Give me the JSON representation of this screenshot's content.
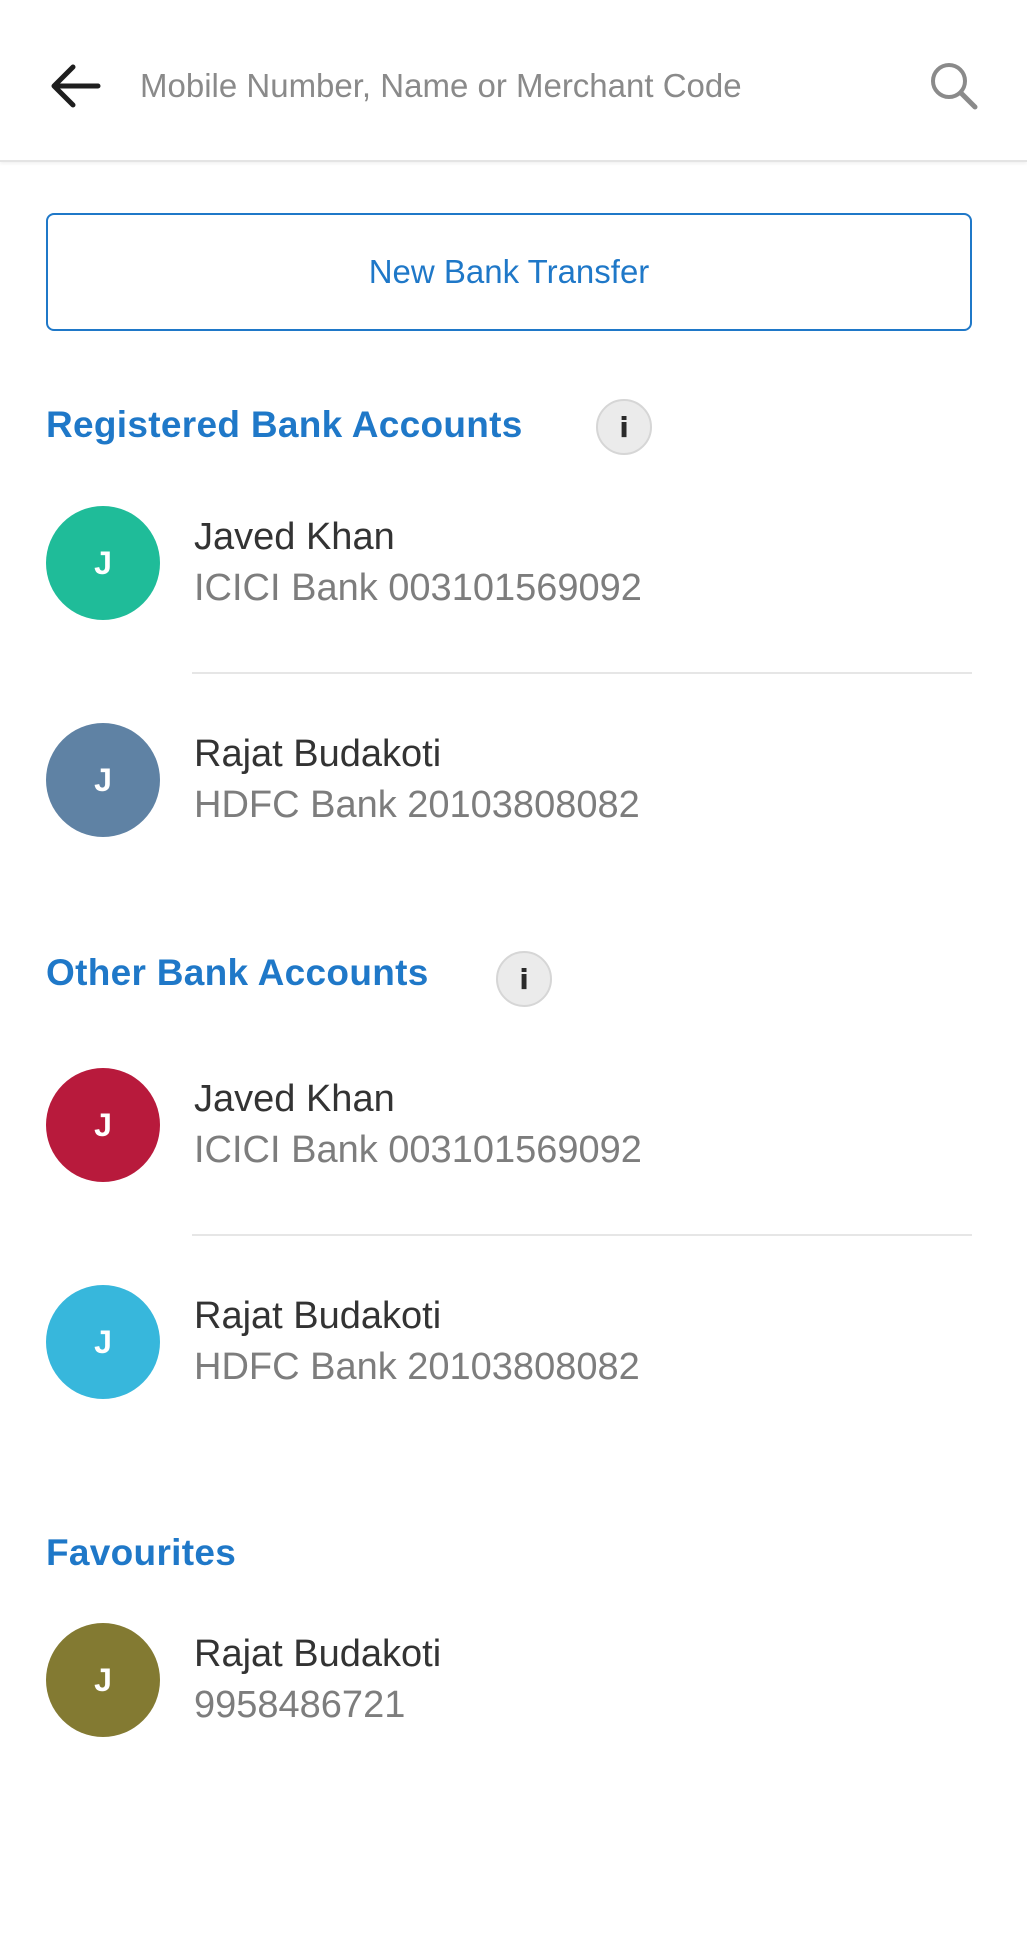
{
  "header": {
    "search_placeholder": "Mobile Number, Name or Merchant Code",
    "back_icon": "arrow-left-icon",
    "search_icon": "search-icon"
  },
  "new_transfer_label": "New Bank Transfer",
  "sections": {
    "registered": {
      "title": "Registered Bank Accounts",
      "info_glyph": "i",
      "items": [
        {
          "initial": "J",
          "name": "Javed Khan",
          "detail": "ICICI Bank 003101569092",
          "color": "#1fbc99"
        },
        {
          "initial": "J",
          "name": "Rajat Budakoti",
          "detail": "HDFC Bank 20103808082",
          "color": "#5f82a4"
        }
      ]
    },
    "other": {
      "title": "Other Bank Accounts",
      "info_glyph": "i",
      "items": [
        {
          "initial": "J",
          "name": "Javed Khan",
          "detail": "ICICI Bank 003101569092",
          "color": "#b81a3c"
        },
        {
          "initial": "J",
          "name": "Rajat Budakoti",
          "detail": "HDFC Bank 20103808082",
          "color": "#37b7dc"
        }
      ]
    },
    "favourites": {
      "title": "Favourites",
      "items": [
        {
          "initial": "J",
          "name": "Rajat Budakoti",
          "detail": "9958486721",
          "color": "#837a32"
        }
      ]
    }
  },
  "colors": {
    "accent": "#1f78c8"
  }
}
